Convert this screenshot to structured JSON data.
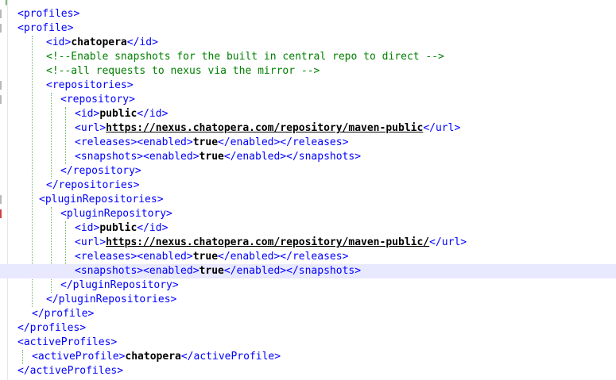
{
  "editor": {
    "colors": {
      "tag": "#0000ff",
      "text": "#000000",
      "comment": "#008000",
      "highlight": "#e8e8ff"
    },
    "lines": [
      {
        "indent": 0,
        "parts": [
          {
            "k": "c",
            "s": "|--"
          }
        ]
      },
      {
        "indent": 1,
        "parts": [
          {
            "k": "t",
            "s": "<profiles>"
          }
        ]
      },
      {
        "indent": 1,
        "parts": [
          {
            "k": "t",
            "s": "<profile>"
          }
        ]
      },
      {
        "indent": 3,
        "parts": [
          {
            "k": "t",
            "s": "<id>"
          },
          {
            "k": "v",
            "s": "chatopera"
          },
          {
            "k": "t",
            "s": "</id>"
          }
        ]
      },
      {
        "indent": 3,
        "parts": [
          {
            "k": "c",
            "s": "<!--Enable snapshots for the built in central repo to direct -->"
          }
        ]
      },
      {
        "indent": 3,
        "parts": [
          {
            "k": "c",
            "s": "<!--all requests to nexus via the mirror -->"
          }
        ]
      },
      {
        "indent": 3,
        "parts": [
          {
            "k": "t",
            "s": "<repositories>"
          }
        ]
      },
      {
        "indent": 4,
        "parts": [
          {
            "k": "t",
            "s": "<repository>"
          }
        ]
      },
      {
        "indent": 5,
        "parts": [
          {
            "k": "t",
            "s": "<id>"
          },
          {
            "k": "v",
            "s": "public"
          },
          {
            "k": "t",
            "s": "</id>"
          }
        ]
      },
      {
        "indent": 5,
        "parts": [
          {
            "k": "t",
            "s": "<url>"
          },
          {
            "k": "u",
            "s": "https://nexus.chatopera.com/repository/maven-public"
          },
          {
            "k": "t",
            "s": "</url>"
          }
        ]
      },
      {
        "indent": 5,
        "parts": [
          {
            "k": "t",
            "s": "<releases><enabled>"
          },
          {
            "k": "v",
            "s": "true"
          },
          {
            "k": "t",
            "s": "</enabled></releases>"
          }
        ]
      },
      {
        "indent": 5,
        "parts": [
          {
            "k": "t",
            "s": "<snapshots><enabled>"
          },
          {
            "k": "v",
            "s": "true"
          },
          {
            "k": "t",
            "s": "</enabled></snapshots>"
          }
        ]
      },
      {
        "indent": 4,
        "parts": [
          {
            "k": "t",
            "s": "</repository>"
          }
        ]
      },
      {
        "indent": 3,
        "parts": [
          {
            "k": "t",
            "s": "</repositories>"
          }
        ]
      },
      {
        "indent": 2.5,
        "parts": [
          {
            "k": "t",
            "s": "<pluginRepositories>"
          }
        ]
      },
      {
        "indent": 4,
        "parts": [
          {
            "k": "t",
            "s": "<pluginRepository>"
          }
        ]
      },
      {
        "indent": 5,
        "parts": [
          {
            "k": "t",
            "s": "<id>"
          },
          {
            "k": "v",
            "s": "public"
          },
          {
            "k": "t",
            "s": "</id>"
          }
        ]
      },
      {
        "indent": 5,
        "parts": [
          {
            "k": "t",
            "s": "<url>"
          },
          {
            "k": "u",
            "s": "https://nexus.chatopera.com/repository/maven-public/"
          },
          {
            "k": "t",
            "s": "</url>"
          }
        ]
      },
      {
        "indent": 5,
        "parts": [
          {
            "k": "t",
            "s": "<releases><enabled>"
          },
          {
            "k": "v",
            "s": "true"
          },
          {
            "k": "t",
            "s": "</enabled></releases>"
          }
        ]
      },
      {
        "indent": 5,
        "highlight": true,
        "parts": [
          {
            "k": "t",
            "s": "<snapshots><enabled>"
          },
          {
            "k": "v",
            "s": "true"
          },
          {
            "k": "t",
            "s": "</enabled></snapshots>"
          }
        ]
      },
      {
        "indent": 4,
        "parts": [
          {
            "k": "t",
            "s": "</pluginRepository>"
          }
        ]
      },
      {
        "indent": 3,
        "parts": [
          {
            "k": "t",
            "s": "</pluginRepositories>"
          }
        ]
      },
      {
        "indent": 2,
        "parts": [
          {
            "k": "t",
            "s": "</profile>"
          }
        ]
      },
      {
        "indent": 1,
        "parts": [
          {
            "k": "t",
            "s": "</profiles>"
          }
        ]
      },
      {
        "indent": 1,
        "parts": [
          {
            "k": "t",
            "s": "<activeProfiles>"
          }
        ]
      },
      {
        "indent": 2,
        "parts": [
          {
            "k": "t",
            "s": "<activeProfile>"
          },
          {
            "k": "v",
            "s": "chatopera"
          },
          {
            "k": "t",
            "s": "</activeProfile>"
          }
        ]
      },
      {
        "indent": 1,
        "parts": [
          {
            "k": "t",
            "s": "</activeProfiles>"
          }
        ]
      }
    ]
  }
}
